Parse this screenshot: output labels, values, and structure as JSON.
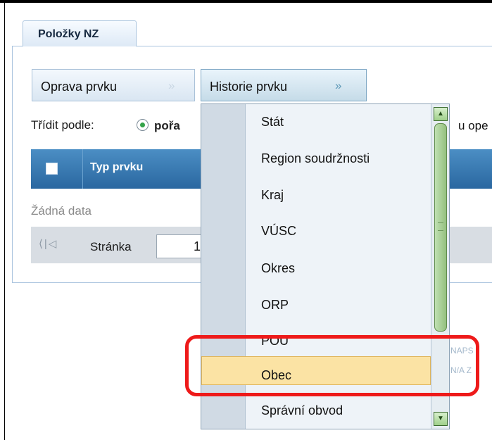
{
  "tab": {
    "label": "Položky NZ"
  },
  "actions": {
    "oprava_label": "Oprava prvku",
    "historie_label": "Historie prvku",
    "chevron": "»"
  },
  "sort": {
    "label": "Třídit podle:",
    "option_label_visible": "pořa",
    "option_tail_visible": "u ope",
    "radio_selected": true
  },
  "grid": {
    "header_typ": "Typ prvku",
    "empty_text": "Žádná data"
  },
  "pager": {
    "label": "Stránka",
    "page_value": "1",
    "nav_icons": "⟨|◁"
  },
  "background_text": {
    "line1": "NAPS",
    "line2": "N/A Z"
  },
  "dropdown": {
    "items": [
      "Stát",
      "Region soudržnosti",
      "Kraj",
      "VÚSC",
      "Okres",
      "ORP",
      "POU",
      "Obec",
      "Správní obvod"
    ],
    "selected_index": 7
  },
  "colors": {
    "header_blue": "#2a67a0",
    "highlight_red": "#ee1a1a",
    "selected_bg": "#fbe3a4",
    "scroll_green": "#9fd08a"
  }
}
